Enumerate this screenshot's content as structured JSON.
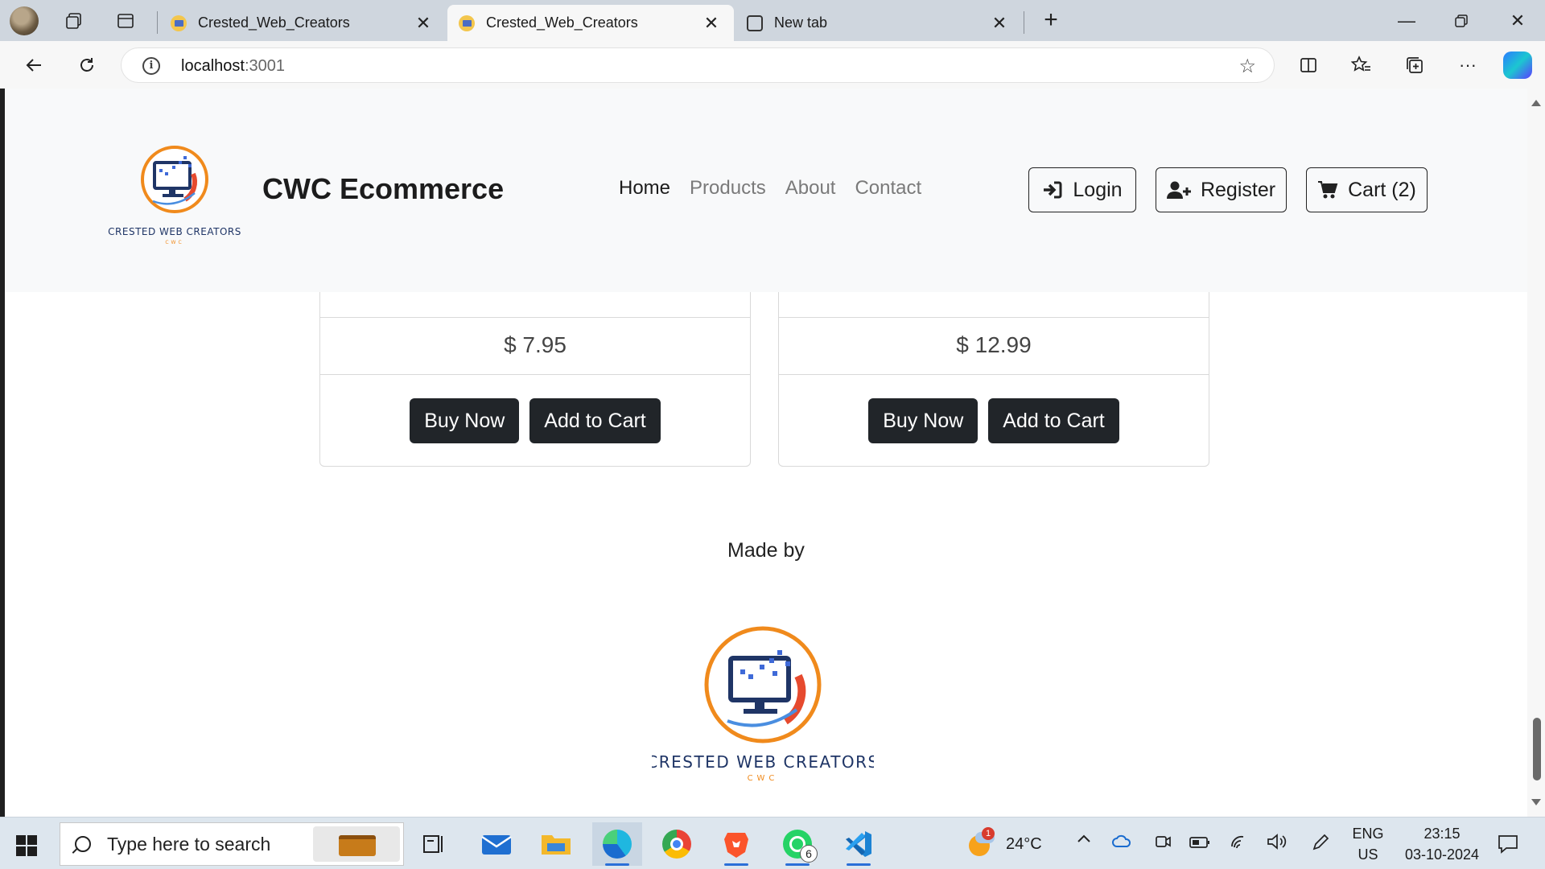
{
  "browser": {
    "tabs": [
      {
        "title": "Crested_Web_Creators",
        "active": false
      },
      {
        "title": "Crested_Web_Creators",
        "active": true
      },
      {
        "title": "New tab",
        "active": false
      }
    ],
    "url_host": "localhost",
    "url_port": ":3001"
  },
  "site": {
    "brand": "CWC Ecommerce",
    "logo_text": "CRESTED WEB CREATORS",
    "logo_sub": "CWC",
    "nav": [
      "Home",
      "Products",
      "About",
      "Contact"
    ],
    "buttons": {
      "login": "Login",
      "register": "Register",
      "cart": "Cart (2)"
    },
    "products": [
      {
        "price": "$ 7.95",
        "buy": "Buy Now",
        "add": "Add to Cart"
      },
      {
        "price": "$ 12.99",
        "buy": "Buy Now",
        "add": "Add to Cart"
      }
    ],
    "footer": {
      "made_by": "Made by"
    }
  },
  "taskbar": {
    "search_placeholder": "Type here to search",
    "whatsapp_badge": "6",
    "weather_badge": "1",
    "weather": "24°C",
    "lang1": "ENG",
    "lang2": "US",
    "time": "23:15",
    "date": "03-10-2024"
  },
  "colors": {
    "dark_button": "#212529",
    "logo_orange": "#f08a1c",
    "logo_navy": "#1f3566",
    "header_bg": "#f8f9fa"
  }
}
